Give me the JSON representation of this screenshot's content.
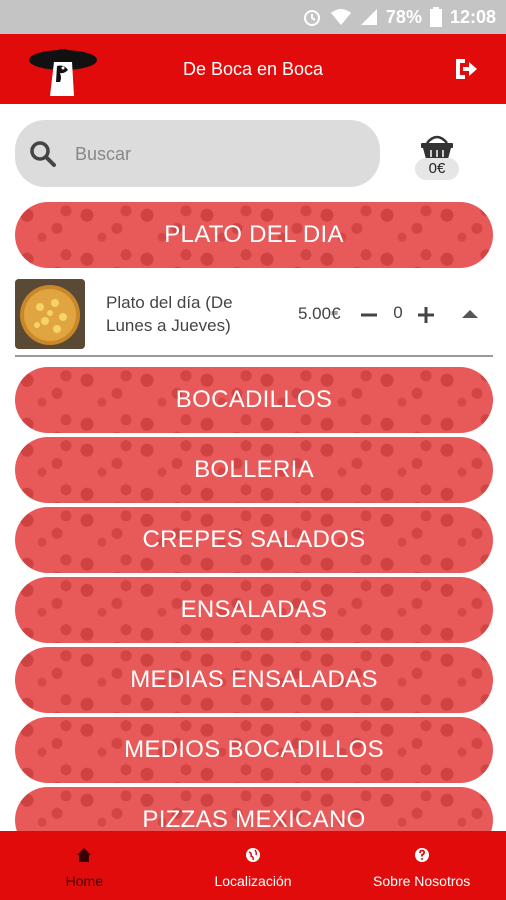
{
  "status_bar": {
    "battery": "78%",
    "time": "12:08"
  },
  "header": {
    "title": "De Boca en Boca"
  },
  "search": {
    "placeholder": "Buscar"
  },
  "cart": {
    "total": "0€"
  },
  "categories": [
    {
      "label": "PLATO DEL DIA"
    },
    {
      "label": "BOCADILLOS"
    },
    {
      "label": "BOLLERIA"
    },
    {
      "label": "CREPES SALADOS"
    },
    {
      "label": "ENSALADAS"
    },
    {
      "label": "MEDIAS ENSALADAS"
    },
    {
      "label": "MEDIOS BOCADILLOS"
    },
    {
      "label": "PIZZAS MEXICANO"
    }
  ],
  "expanded_item": {
    "name": "Plato del día (De Lunes a Jueves)",
    "price": "5.00€",
    "quantity": "0"
  },
  "bottom_nav": [
    {
      "label": "Home",
      "icon": "home-icon",
      "active": true
    },
    {
      "label": "Localización",
      "icon": "globe-icon",
      "active": false
    },
    {
      "label": "Sobre Nosotros",
      "icon": "question-icon",
      "active": false
    }
  ],
  "colors": {
    "brand_red": "#e10b0b",
    "category_red": "#e85a5a",
    "status_bar": "#c4c4c4"
  }
}
